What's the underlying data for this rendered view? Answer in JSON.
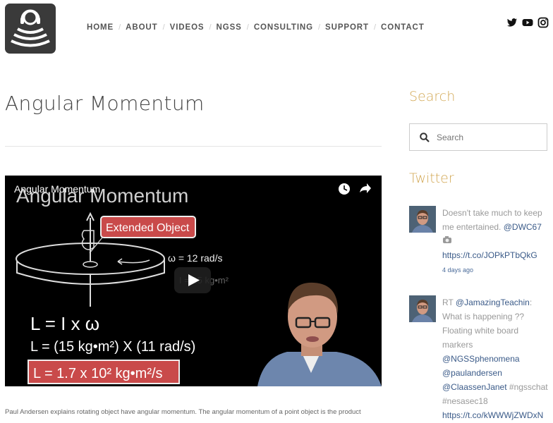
{
  "nav": {
    "items": [
      "HOME",
      "ABOUT",
      "VIDEOS",
      "NGSS",
      "CONSULTING",
      "SUPPORT",
      "CONTACT"
    ]
  },
  "social": [
    "twitter-icon",
    "youtube-icon",
    "instagram-icon"
  ],
  "page": {
    "title": "Angular Momentum",
    "caption": "Paul Andersen explains rotating object have angular momentum. The angular momentum of a point object is the product"
  },
  "video": {
    "overlay_title": "Angular Momentum",
    "slide_title": "Angular Momentum",
    "callout": "Extended Object",
    "omega": "ω = 12 rad/s",
    "inertia": "I = 15 kg•m²",
    "eq1": "L = I x ω",
    "eq2": "L = (15 kg•m²) X (11 rad/s)",
    "result": "L = 1.7 x 10² kg•m²/s"
  },
  "sidebar": {
    "search_heading": "Search",
    "search_placeholder": "Search",
    "twitter_heading": "Twitter",
    "tweets": [
      {
        "text": "Doesn't take much to keep me entertained. ",
        "handle": "@DWC67",
        "link": "https://t.co/JOPkPTbQkG",
        "time": "4 days ago"
      },
      {
        "prefix": "RT ",
        "handle": "@JamazingTeachin",
        "text": ": What is happening ?? Floating white board markers ",
        "mentions": "@NGSSphenomena @paulandersen @ClaassenJanet",
        "tags": " #ngsschat #nesasec18 ",
        "link": "https://t.co/kWWWjZWDxN"
      }
    ]
  }
}
